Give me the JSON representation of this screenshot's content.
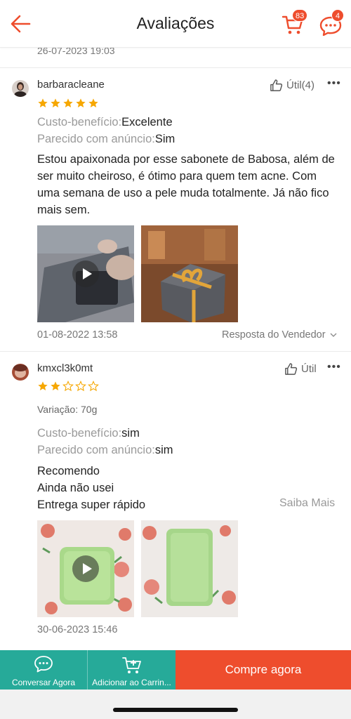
{
  "header": {
    "title": "Avaliações",
    "cart_count": "83",
    "chat_count": "4"
  },
  "top_date": "26-07-2023 19:03",
  "reviews": [
    {
      "username": "barbaracleane",
      "helpful_label": "Útil(4)",
      "rating": 5,
      "cost_benefit_key": "Custo-benefício:",
      "cost_benefit_value": "Excelente",
      "similar_key": "Parecido com anúncio:",
      "similar_value": "Sim",
      "text": "Estou apaixonada por esse sabonete de Babosa, além de ser muito cheiroso, é ótimo para quem tem acne. Com uma semana de uso a pele muda totalmente. Já não fico mais sem.",
      "date": "01-08-2022 13:58",
      "seller_reply": "Resposta do Vendedor"
    },
    {
      "username": "kmxcl3k0mt",
      "helpful_label": "Útil",
      "rating": 2,
      "variation": "Variação: 70g",
      "cost_benefit_key": "Custo-benefício:",
      "cost_benefit_value": "sim",
      "similar_key": "Parecido com anúncio:",
      "similar_value": "sim",
      "lines": [
        "Recomendo",
        "Ainda não usei",
        "Entrega super rápido"
      ],
      "more_label": "Saiba Mais",
      "date": "30-06-2023 15:46"
    }
  ],
  "bottom_bar": {
    "chat_label": "Conversar Agora",
    "add_cart_label": "Adicionar ao Carrin...",
    "buy_label": "Compre agora"
  },
  "colors": {
    "accent": "#ee4d2d",
    "teal": "#26aa99",
    "star": "#f6a700"
  }
}
